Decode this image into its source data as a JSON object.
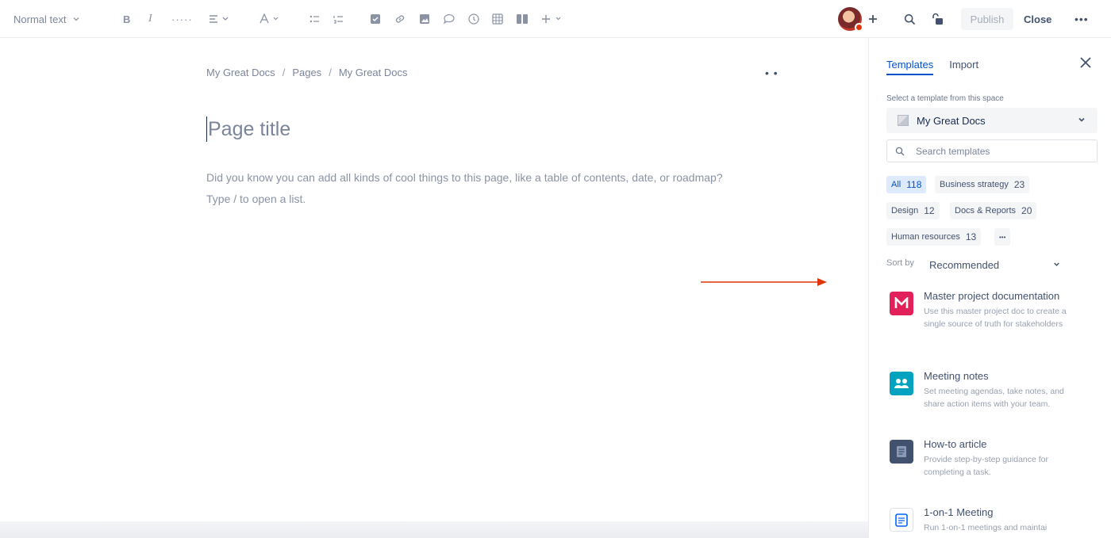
{
  "toolbar": {
    "text_style": "Normal text",
    "icons": [
      "bold-icon",
      "italic-icon",
      "more-formatting-icon",
      "align-icon",
      "text-color-icon",
      "bullet-list-icon",
      "numbered-list-icon",
      "task-icon",
      "link-icon",
      "image-icon",
      "mention-icon",
      "emoji-icon",
      "table-icon",
      "layout-icon",
      "insert-icon"
    ],
    "publish_label": "Publish",
    "close_label": "Close"
  },
  "editor": {
    "breadcrumb": [
      "My Great Docs",
      "Pages",
      "My Great Docs"
    ],
    "breadcrumb_sep": "/",
    "title_placeholder": "Page title",
    "hint_line1": "Did you know you can add all kinds of cool things to this page, like a table of contents, date, or roadmap?",
    "hint_line2": "Type / to open a list."
  },
  "panel": {
    "tabs": [
      {
        "label": "Templates",
        "active": true
      },
      {
        "label": "Import",
        "active": false
      }
    ],
    "select_label": "Select a template from this space",
    "space_name": "My Great Docs",
    "search_placeholder": "Search templates",
    "chips": [
      {
        "label": "All",
        "count": "118",
        "active": true
      },
      {
        "label": "Business strategy",
        "count": "23"
      },
      {
        "label": "Design",
        "count": "12"
      },
      {
        "label": "Docs & Reports",
        "count": "20"
      },
      {
        "label": "Human resources",
        "count": "13"
      }
    ],
    "more_chip": "•••",
    "sort_label": "Sort by",
    "sort_value": "Recommended",
    "templates": [
      {
        "name": "Master project documentation",
        "desc": "Use this master project doc to create a single source of truth for stakeholders",
        "icon": "M",
        "color": "#e2215a"
      },
      {
        "name": "Meeting notes",
        "desc": "Set meeting agendas, take notes, and share action items with your team.",
        "icon": "people-icon",
        "color": "#00a3bf"
      },
      {
        "name": "How-to article",
        "desc": "Provide step-by-step guidance for completing a task.",
        "icon": "article-icon",
        "color": "#42526e"
      },
      {
        "name": "1-on-1 Meeting",
        "desc": "Run 1-on-1 meetings and maintai",
        "icon": "calendar-icon",
        "color": "#0065ff"
      }
    ]
  },
  "accent_color": "#0052cc",
  "arrow_color": "#de350b"
}
